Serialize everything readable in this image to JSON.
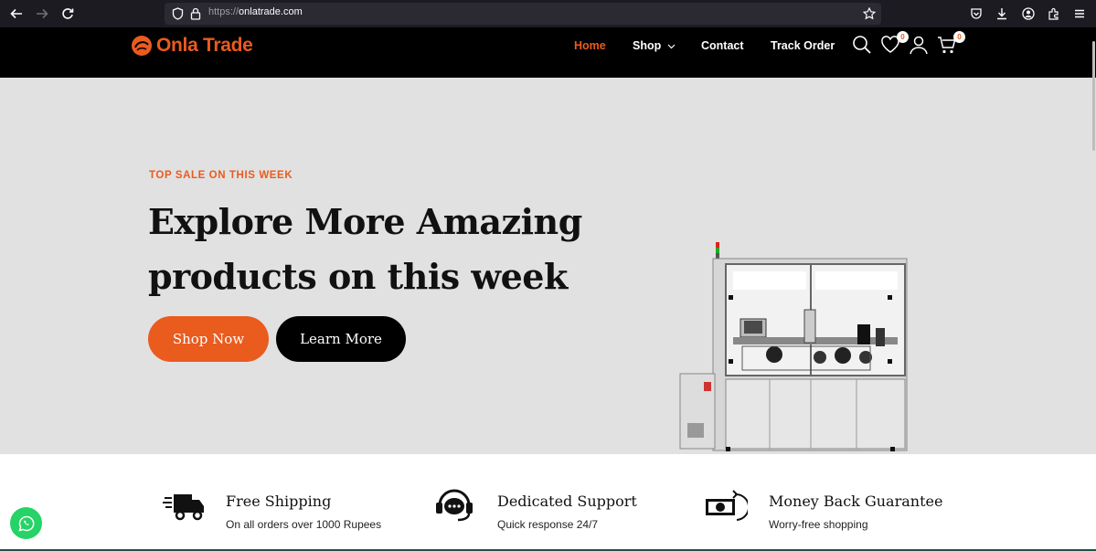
{
  "browser": {
    "url_protocol": "https://",
    "url_host": "onlatrade.com",
    "icons": [
      "back-arrow-icon",
      "forward-arrow-icon",
      "reload-icon",
      "shield-icon",
      "lock-icon",
      "star-icon",
      "pocket-icon",
      "download-icon",
      "account-icon",
      "extensions-icon",
      "menu-icon"
    ]
  },
  "header": {
    "logo_text": "Onla Trade",
    "nav": {
      "home": "Home",
      "shop": "Shop",
      "contact": "Contact",
      "track_order": "Track Order"
    },
    "wishlist_count": "0",
    "cart_count": "0"
  },
  "hero": {
    "kicker": "TOP SALE ON THIS WEEK",
    "title_line1": "Explore More Amazing",
    "title_line2": "products on this week",
    "shop_now": "Shop Now",
    "learn_more": "Learn More"
  },
  "features": [
    {
      "title": "Free Shipping",
      "subtitle": "On all orders over 1000 Rupees",
      "icon": "truck-icon"
    },
    {
      "title": "Dedicated Support",
      "subtitle": "Quick response 24/7",
      "icon": "support-icon"
    },
    {
      "title": "Money Back Guarantee",
      "subtitle": "Worry-free shopping",
      "icon": "money-back-icon"
    }
  ],
  "colors": {
    "accent": "#ea5b1e",
    "header_bg": "#000000",
    "hero_bg": "#e2e1e1",
    "whatsapp": "#25d366"
  }
}
